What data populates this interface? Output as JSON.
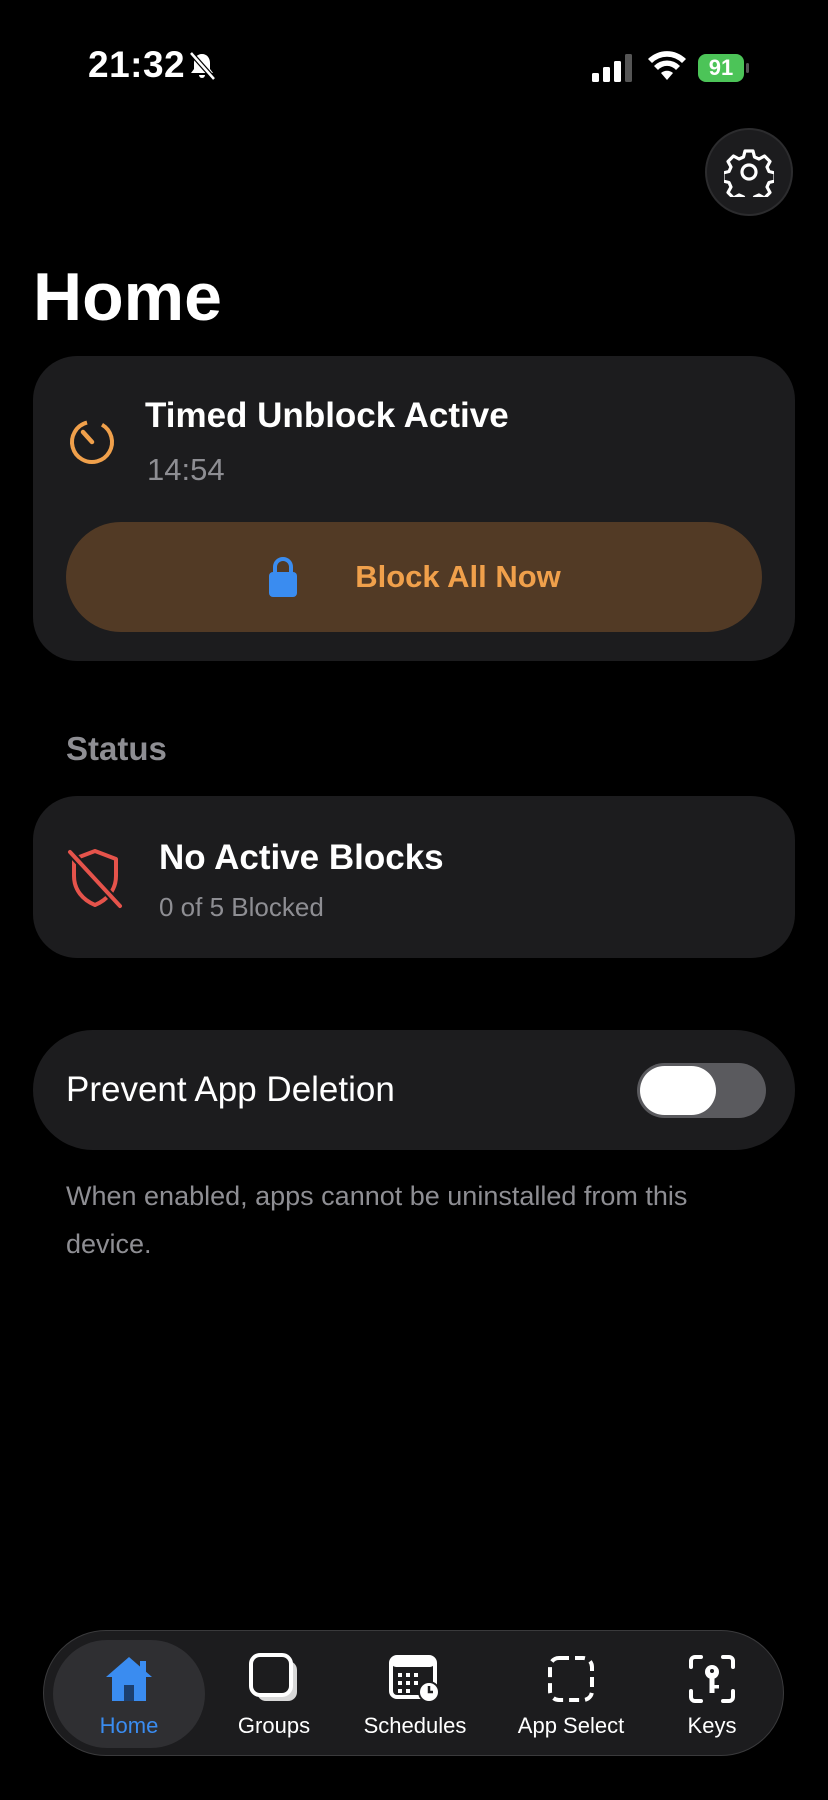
{
  "status_bar": {
    "time": "21:32",
    "battery_percent": "91",
    "battery_color": "#4cc458"
  },
  "header": {
    "title": "Home",
    "settings_icon": "gear-icon"
  },
  "timed_unblock": {
    "title": "Timed Unblock Active",
    "remaining": "14:54",
    "button_label": "Block All Now",
    "accent_color": "#f0a04b"
  },
  "status_section": {
    "heading": "Status",
    "title": "No Active Blocks",
    "subtitle": "0 of 5 Blocked"
  },
  "prevent_deletion": {
    "label": "Prevent App Deletion",
    "enabled": false,
    "help": "When enabled, apps cannot be uninstalled from this device."
  },
  "tabs": [
    {
      "label": "Home",
      "icon": "house-icon",
      "active": true
    },
    {
      "label": "Groups",
      "icon": "groups-icon",
      "active": false
    },
    {
      "label": "Schedules",
      "icon": "calendar-clock-icon",
      "active": false
    },
    {
      "label": "App Select",
      "icon": "dashed-square-icon",
      "active": false
    },
    {
      "label": "Keys",
      "icon": "key-icon",
      "active": false
    }
  ]
}
